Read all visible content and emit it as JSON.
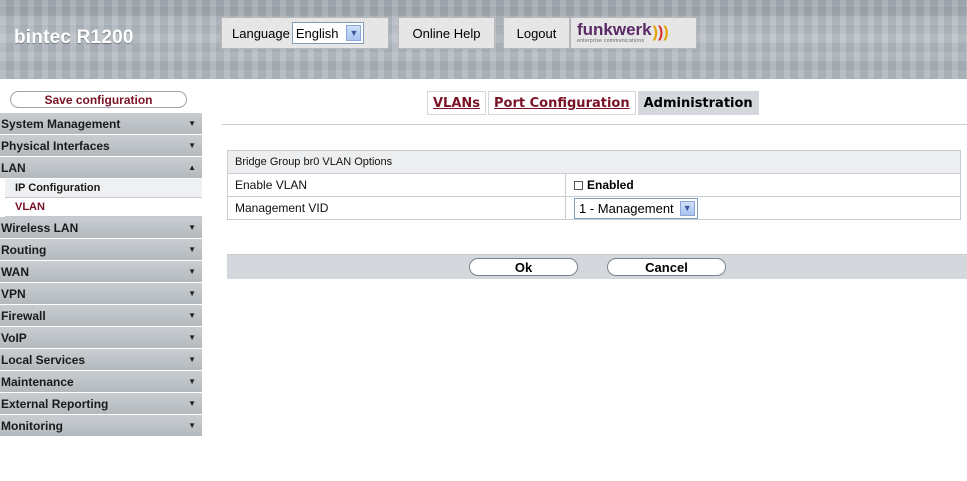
{
  "header": {
    "brand": "bintec R1200",
    "language_label": "Language",
    "language_value": "English",
    "online_help": "Online Help",
    "logout": "Logout",
    "logo_text": "funkwerk",
    "logo_sub": "enterprise communications"
  },
  "sidebar": {
    "save_label": "Save configuration",
    "items": [
      {
        "label": "System Management"
      },
      {
        "label": "Physical Interfaces"
      },
      {
        "label": "LAN"
      },
      {
        "label": "Wireless LAN"
      },
      {
        "label": "Routing"
      },
      {
        "label": "WAN"
      },
      {
        "label": "VPN"
      },
      {
        "label": "Firewall"
      },
      {
        "label": "VoIP"
      },
      {
        "label": "Local Services"
      },
      {
        "label": "Maintenance"
      },
      {
        "label": "External Reporting"
      },
      {
        "label": "Monitoring"
      }
    ],
    "lan_sub": [
      {
        "label": "IP Configuration"
      },
      {
        "label": "VLAN"
      }
    ]
  },
  "tabs": [
    {
      "label": "VLANs"
    },
    {
      "label": "Port Configuration"
    },
    {
      "label": "Administration"
    }
  ],
  "form": {
    "section_title": "Bridge Group br0 VLAN Options",
    "enable_vlan_label": "Enable VLAN",
    "enable_vlan_checkbox_label": "Enabled",
    "enable_vlan_checked": false,
    "management_vid_label": "Management VID",
    "management_vid_value": "1 - Management"
  },
  "actions": {
    "ok": "Ok",
    "cancel": "Cancel"
  },
  "colors": {
    "accent": "#7a1225",
    "nav_bg": "#b4b9be",
    "tab_active_bg": "#d4d8dc"
  }
}
